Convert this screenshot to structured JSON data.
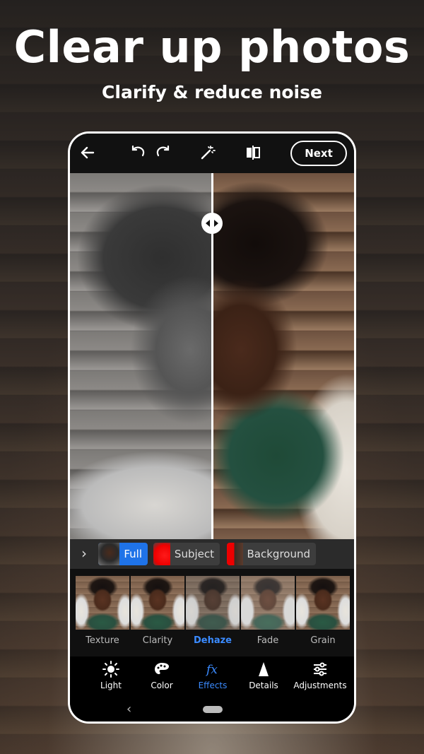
{
  "promo": {
    "headline": "Clear up photos",
    "subheadline": "Clarify & reduce noise"
  },
  "toolbar": {
    "back_icon": "arrow-left-icon",
    "undo_icon": "undo-icon",
    "redo_icon": "redo-icon",
    "auto_icon": "magic-wand-icon",
    "compare_icon": "compare-icon",
    "next_label": "Next"
  },
  "mask": {
    "options": [
      {
        "label": "Full",
        "selected": true
      },
      {
        "label": "Subject",
        "selected": false
      },
      {
        "label": "Background",
        "selected": false
      }
    ]
  },
  "effects": {
    "items": [
      {
        "label": "Texture",
        "active": false
      },
      {
        "label": "Clarity",
        "active": false
      },
      {
        "label": "Dehaze",
        "active": true
      },
      {
        "label": "Fade",
        "active": false
      },
      {
        "label": "Grain",
        "active": false
      }
    ]
  },
  "tabs": {
    "items": [
      {
        "label": "Light",
        "icon": "sun-icon",
        "active": false
      },
      {
        "label": "Color",
        "icon": "palette-icon",
        "active": false
      },
      {
        "label": "Effects",
        "icon": "fx-icon",
        "active": true
      },
      {
        "label": "Details",
        "icon": "triangle-icon",
        "active": false
      },
      {
        "label": "Adjustments",
        "icon": "sliders-icon",
        "active": false
      }
    ]
  },
  "colors": {
    "accent": "#1f73e8",
    "active_text": "#3b8bff",
    "subject_mask": "#ff0000"
  }
}
